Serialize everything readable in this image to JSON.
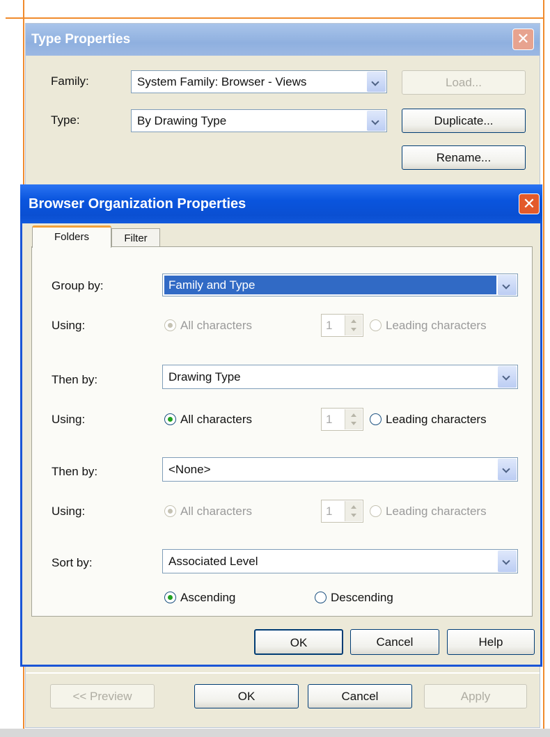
{
  "type_properties": {
    "title": "Type Properties",
    "family_label": "Family:",
    "family_value": "System Family: Browser - Views",
    "type_label": "Type:",
    "type_value": "By Drawing Type",
    "load_label": "Load...",
    "duplicate_label": "Duplicate...",
    "rename_label": "Rename...",
    "preview_label": "<< Preview",
    "ok_label": "OK",
    "cancel_label": "Cancel",
    "apply_label": "Apply"
  },
  "browser_org": {
    "title": "Browser Organization Properties",
    "tabs": [
      {
        "label": "Folders",
        "active": true
      },
      {
        "label": "Filter",
        "active": false
      }
    ],
    "group_by": {
      "label": "Group by:",
      "value": "Family and Type",
      "using_label": "Using:",
      "all_characters": "All characters",
      "count": "1",
      "leading_characters": "Leading characters",
      "enabled": false
    },
    "then_by_1": {
      "label": "Then by:",
      "value": "Drawing Type",
      "using_label": "Using:",
      "all_characters": "All characters",
      "count": "1",
      "leading_characters": "Leading characters",
      "enabled": true
    },
    "then_by_2": {
      "label": "Then by:",
      "value": "<None>",
      "using_label": "Using:",
      "all_characters": "All characters",
      "count": "1",
      "leading_characters": "Leading characters",
      "enabled": false
    },
    "sort_by": {
      "label": "Sort by:",
      "value": "Associated Level",
      "ascending": "Ascending",
      "descending": "Descending",
      "selected": "ascending"
    },
    "ok_label": "OK",
    "cancel_label": "Cancel",
    "help_label": "Help"
  },
  "close_glyph": "✕",
  "colors": {
    "guide": "#f08a2c",
    "xp_title": "#0a55de",
    "selection": "#316ac5",
    "radio_dot": "#21a121"
  }
}
